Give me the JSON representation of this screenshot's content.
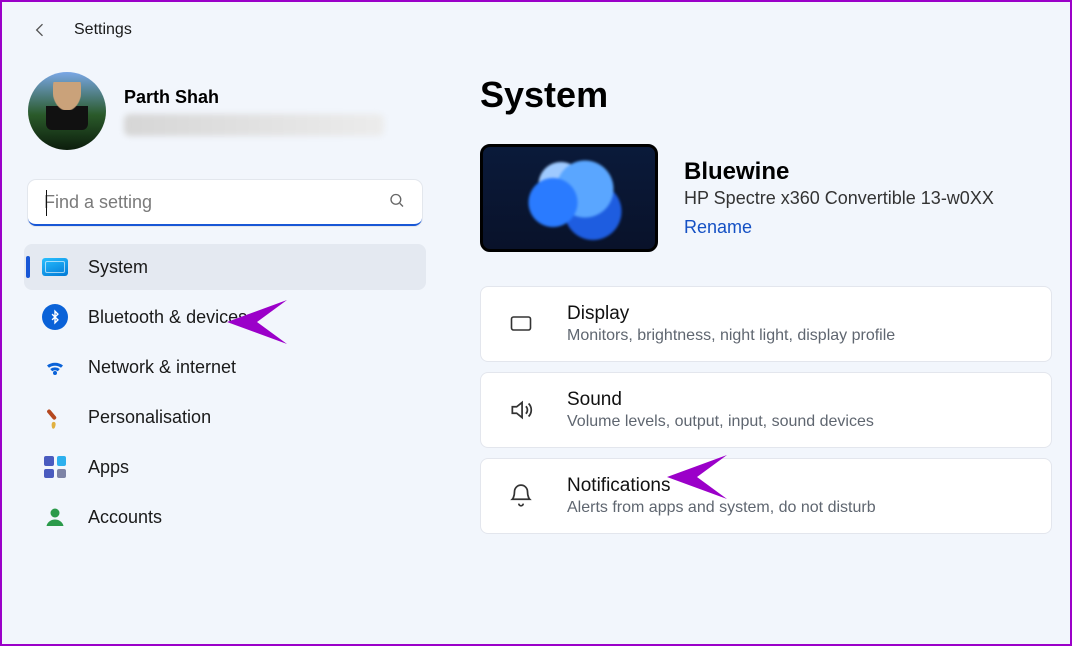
{
  "header": {
    "app_title": "Settings"
  },
  "profile": {
    "username": "Parth Shah"
  },
  "search": {
    "placeholder": "Find a setting"
  },
  "nav": {
    "items": [
      {
        "label": "System"
      },
      {
        "label": "Bluetooth & devices"
      },
      {
        "label": "Network & internet"
      },
      {
        "label": "Personalisation"
      },
      {
        "label": "Apps"
      },
      {
        "label": "Accounts"
      }
    ]
  },
  "main": {
    "page_title": "System",
    "device": {
      "name": "Bluewine",
      "model": "HP Spectre x360 Convertible 13-w0XX",
      "rename": "Rename"
    },
    "cards": [
      {
        "title": "Display",
        "sub": "Monitors, brightness, night light, display profile"
      },
      {
        "title": "Sound",
        "sub": "Volume levels, output, input, sound devices"
      },
      {
        "title": "Notifications",
        "sub": "Alerts from apps and system, do not disturb"
      }
    ]
  },
  "colors": {
    "accent": "#1857d6",
    "arrow": "#9b00c9"
  }
}
